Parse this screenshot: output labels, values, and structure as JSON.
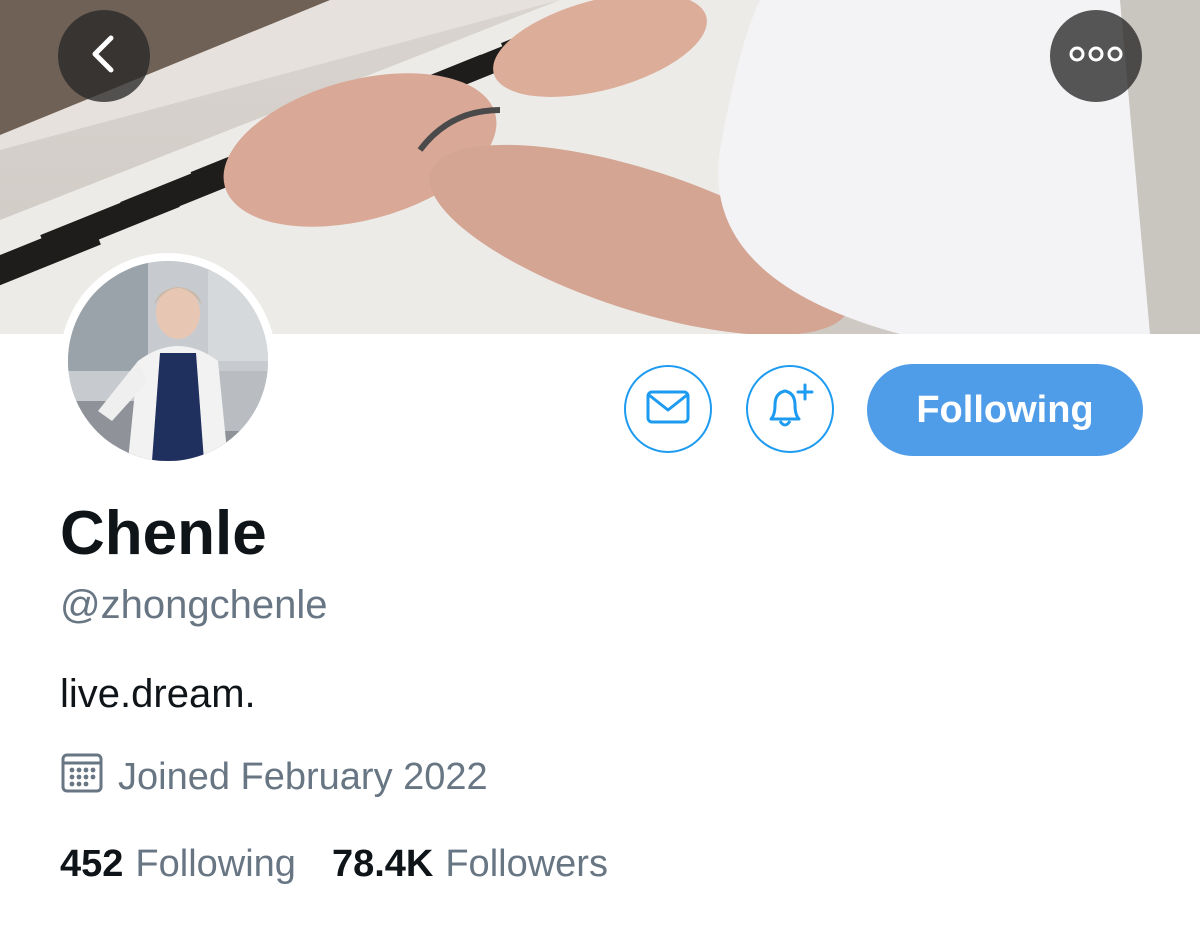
{
  "header": {
    "back_icon": "chevron-left-icon",
    "more_icon": "more-dots-icon"
  },
  "profile": {
    "display_name": "Chenle",
    "handle": "@zhongchenle",
    "bio": "live.dream.",
    "joined": "Joined February 2022",
    "following_count": "452",
    "following_label": "Following",
    "followers_count": "78.4K",
    "followers_label": "Followers"
  },
  "actions": {
    "message_icon": "mail-icon",
    "notify_icon": "bell-plus-icon",
    "follow_label": "Following"
  },
  "colors": {
    "accent": "#1d9bf0",
    "follow_button": "#4f9ce8",
    "secondary_text": "#687684"
  }
}
